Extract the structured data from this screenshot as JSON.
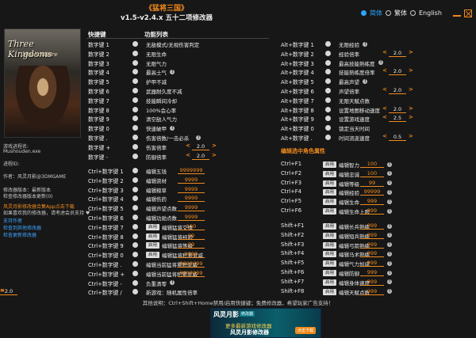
{
  "title": "《猛将三国》",
  "version": "v1.5-v2.4.x 五十二项修改器",
  "lang": {
    "items": [
      "简体",
      "繁体",
      "English"
    ],
    "selected": 0
  },
  "game": {
    "logo1": "Three Kingdoms",
    "logo2": "Mushoudere",
    "process_label": "游戏进程名:",
    "process": "Mushouden.exe",
    "pid_label": "进程ID:",
    "author": "作者：风灵月影@3DMGAME",
    "version_line": "修改器版本：最新版本",
    "check_update": "检查修改器版本更新(0)",
    "app_link": "风灵月影修改器合集App点击下载",
    "app_desc": "如果喜欢我的修改器，请考虑会员支持 ♥",
    "link1": "支持作者",
    "link2": "检查到其他修改器",
    "link3": "检查更新修改器"
  },
  "headers": {
    "hotkey": "快捷键",
    "features": "功能列表"
  },
  "left_top": [
    {
      "key": "数字键 1",
      "label": "无敌模式/无视伤害判定"
    },
    {
      "key": "数字键 2",
      "label": "无限生命"
    },
    {
      "key": "数字键 3",
      "label": "无限气力"
    },
    {
      "key": "数字键 4",
      "label": "最高士气",
      "info": true
    },
    {
      "key": "数字键 5",
      "label": "护甲不减"
    },
    {
      "key": "数字键 6",
      "label": "武器耐久度不减"
    },
    {
      "key": "数字键 7",
      "label": "技能瞬间冷却"
    },
    {
      "key": "数字键 8",
      "label": "100%会心率"
    },
    {
      "key": "数字键 9",
      "label": "清空敌人气力"
    },
    {
      "key": "数字键 0",
      "label": "快速破甲",
      "info": true
    },
    {
      "key": "数字键 .",
      "label": "伤害倍数/一击必杀",
      "info": true
    },
    {
      "key": "数字键 +",
      "label": "伤害倍率",
      "step": "2.0"
    },
    {
      "key": "数字键 -",
      "label": "防御倍率",
      "step": "2.0"
    }
  ],
  "left_mid": [
    {
      "key": "Ctrl+数字键 1",
      "label": "编辑五钱",
      "value": "9999999"
    },
    {
      "key": "Ctrl+数字键 2",
      "label": "编辑资材",
      "value": "9999"
    },
    {
      "key": "Ctrl+数字键 3",
      "label": "编辑粮草",
      "value": "9999"
    },
    {
      "key": "Ctrl+数字键 4",
      "label": "编辑伤药",
      "value": "9999"
    },
    {
      "key": "Ctrl+数字键 5",
      "label": "编辑声望点数",
      "value": "9999"
    },
    {
      "key": "Ctrl+数字键 6",
      "label": "编辑功勋点数",
      "value": "9999"
    },
    {
      "key": "Ctrl+数字键 7",
      "label": "编辑猛将交情",
      "value": "100",
      "apply": "启用"
    },
    {
      "key": "Ctrl+数字键 8",
      "label": "编辑猛将经验",
      "value": "99",
      "apply": "启用"
    },
    {
      "key": "Ctrl+数字键 9",
      "label": "编辑猛将等级",
      "value": "99",
      "apply": "启用"
    },
    {
      "key": "Ctrl+数字键 0",
      "label": "编辑猛将积累武威",
      "value": "9999",
      "apply": "启用"
    },
    {
      "key": "Ctrl+数字键 .",
      "label": "编辑当前猛将累积武威",
      "value": "9999999"
    },
    {
      "key": "Ctrl+数字键 +",
      "label": "编辑当前猛将积累武威",
      "value": "9999999"
    },
    {
      "key": "Ctrl+数字键 -",
      "label": "负重清零",
      "info": true
    },
    {
      "key": "Ctrl+数字键 /",
      "label": "新游戏：随机属性倍率",
      "step": "2.0"
    }
  ],
  "right_top": [
    {
      "key": "Alt+数字键 1",
      "label": "无限经验",
      "info": true
    },
    {
      "key": "Alt+数字键 2",
      "label": "经验倍率",
      "step": "2.0"
    },
    {
      "key": "Alt+数字键 3",
      "label": "最高技能熟练度",
      "info": true
    },
    {
      "key": "Alt+数字键 4",
      "label": "技能熟练度倍率",
      "step": "2.0"
    },
    {
      "key": "Alt+数字键 5",
      "label": "最高声望",
      "info": true
    },
    {
      "key": "Alt+数字键 6",
      "label": "声望倍率",
      "step": "2.0"
    },
    {
      "key": "Alt+数字键 7",
      "label": "无限天赋点数"
    },
    {
      "key": "Alt+数字键 8",
      "label": "设置地图移动速度",
      "step": "2.0"
    },
    {
      "key": "Alt+数字键 9",
      "label": "设置游戏速度",
      "step": "2.5"
    },
    {
      "key": "Alt+数字键 0",
      "label": "锁定当天时间"
    },
    {
      "key": "Alt+数字键 .",
      "label": "时间流逝速度",
      "step": "0.5"
    }
  ],
  "attr_header": "编辑选中角色属性",
  "right_mid": [
    {
      "key": "Ctrl+F1",
      "label": "编辑智力",
      "value": "100"
    },
    {
      "key": "Ctrl+F2",
      "label": "编辑忠诚",
      "value": "100"
    },
    {
      "key": "Ctrl+F3",
      "label": "编辑等级",
      "value": "99"
    },
    {
      "key": "Ctrl+F4",
      "label": "编辑经验",
      "value": "99999"
    },
    {
      "key": "Ctrl+F5",
      "label": "编辑生命",
      "value": "999"
    },
    {
      "key": "Ctrl+F6",
      "label": "编辑生命上限",
      "value": "999"
    }
  ],
  "right_bot": [
    {
      "key": "Shift+F1",
      "label": "编辑长兵熟练",
      "value": "999"
    },
    {
      "key": "Shift+F2",
      "label": "编辑短兵熟练",
      "value": "999"
    },
    {
      "key": "Shift+F3",
      "label": "编辑弓箭熟练",
      "value": "999"
    },
    {
      "key": "Shift+F4",
      "label": "编辑马术熟练",
      "value": "999"
    },
    {
      "key": "Shift+F5",
      "label": "编辑气力加成",
      "value": "999"
    },
    {
      "key": "Shift+F6",
      "label": "编辑防御",
      "value": "999"
    },
    {
      "key": "Shift+F7",
      "label": "编辑身体速度",
      "value": "999"
    },
    {
      "key": "Shift+F8",
      "label": "编辑天赋点数",
      "value": "999"
    }
  ],
  "apply_label": "启用",
  "footer": "其他说明：Ctrl+Shift+Home禁用/启用快捷键；免费修改器，希望玩家广告支持！",
  "banner": {
    "brand": "风灵月影",
    "tag": "修改器",
    "line1": "更多最新游戏修改器",
    "line2": "风灵月影修改器",
    "btn": "点击下载"
  }
}
